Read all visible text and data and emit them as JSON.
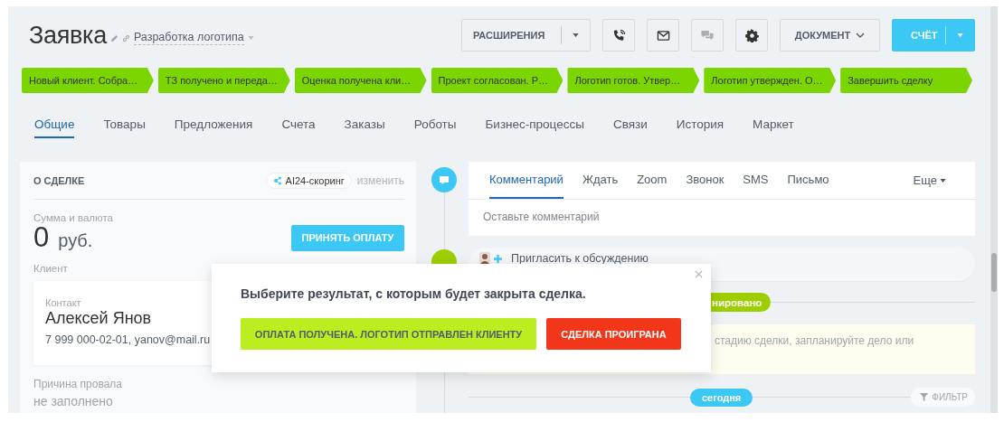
{
  "title": "Заявка",
  "deal_name": "Разработка логотипа",
  "toolbar": {
    "extensions": "РАСШИРЕНИЯ",
    "icons": [
      {
        "kind": "phone",
        "disabled": false
      },
      {
        "kind": "mail",
        "disabled": false
      },
      {
        "kind": "chat",
        "disabled": true
      },
      {
        "kind": "gear",
        "disabled": false
      }
    ],
    "document": "ДОКУМЕНТ",
    "invoice": "СЧЁТ"
  },
  "stages": [
    {
      "label": "Новый клиент. Собра…"
    },
    {
      "label": "ТЗ получено и переда…"
    },
    {
      "label": "Оценка получена кли…"
    },
    {
      "label": "Проект согласован. Р…"
    },
    {
      "label": "Логотип готов. Утвер…"
    },
    {
      "label": "Логотип утвержден. О…"
    },
    {
      "label": "Завершить сделку"
    }
  ],
  "tabs": [
    {
      "label": "Общие",
      "selected": true
    },
    {
      "label": "Товары",
      "selected": false
    },
    {
      "label": "Предложения",
      "selected": false
    },
    {
      "label": "Счета",
      "selected": false
    },
    {
      "label": "Заказы",
      "selected": false
    },
    {
      "label": "Роботы",
      "selected": false
    },
    {
      "label": "Бизнес-процессы",
      "selected": false
    },
    {
      "label": "Связи",
      "selected": false
    },
    {
      "label": "История",
      "selected": false
    },
    {
      "label": "Маркет",
      "selected": false
    }
  ],
  "deal_card": {
    "heading": "О СДЕЛКЕ",
    "scoring": "AI24-скоринг",
    "edit": "изменить",
    "amount_label": "Сумма и валюта",
    "amount": "0",
    "currency": "руб.",
    "pay_button": "ПРИНЯТЬ ОПЛАТУ",
    "client_label": "Клиент",
    "contact": {
      "label": "Контакт",
      "name": "Алексей Янов",
      "details": "7 999 000-02-01, yanov@mail.ru"
    },
    "failure_label": "Причина провала",
    "failure_value": "не заполнено"
  },
  "timeline": {
    "tabs": [
      {
        "label": "Комментарий",
        "selected": true
      },
      {
        "label": "Ждать",
        "selected": false
      },
      {
        "label": "Zoom",
        "selected": false
      },
      {
        "label": "Звонок",
        "selected": false
      },
      {
        "label": "SMS",
        "selected": false
      },
      {
        "label": "Письмо",
        "selected": false
      }
    ],
    "more": "Еще",
    "comment_placeholder": "Оставьте комментарий",
    "invite": "Пригласить к обсуждению",
    "planned_badge": "нировано",
    "hint": "стадию сделки, запланируйте дело или",
    "today_badge": "сегодня",
    "filter": "ФИЛЬТР"
  },
  "popup": {
    "message": "Выберите результат, с которым будет закрыта сделка.",
    "buttons": [
      {
        "label": "ОПЛАТА ПОЛУЧЕНА. ЛОГОТИП ОТПРАВЛЕН КЛИЕНТУ",
        "kind": "success"
      },
      {
        "label": "СДЕЛКА ПРОИГРАНА",
        "kind": "failure"
      }
    ]
  }
}
